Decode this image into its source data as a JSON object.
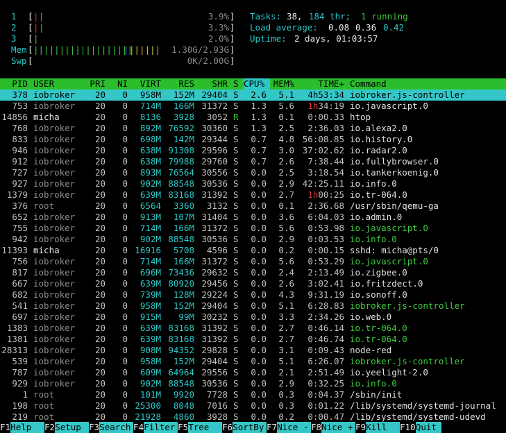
{
  "meters": {
    "cpus": [
      {
        "id": "1",
        "percent": "3.9%",
        "red_bars": "|",
        "green_bars": "|"
      },
      {
        "id": "2",
        "percent": "3.3%",
        "red_bars": "|",
        "green_bars": "|"
      },
      {
        "id": "3",
        "percent": "2.0%",
        "red_bars": "",
        "green_bars": "|"
      }
    ],
    "mem": {
      "label": "Mem",
      "green_bars": "|||||||||||||||||||",
      "blue_bars": "|",
      "yellow_bars": "||||||",
      "value": "1.30G/2.93G"
    },
    "swp": {
      "label": "Swp",
      "value": "0K/2.00G"
    }
  },
  "summary": {
    "tasks_label": "Tasks:",
    "tasks_value": "38,",
    "threads_value": "184 thr;",
    "running_value": "1 running",
    "load_label": "Load average:",
    "load_1": "0.08",
    "load_5": "0.36",
    "load_15": "0.42",
    "uptime_label": "Uptime:",
    "uptime_value": "2 days, 01:03:57"
  },
  "columns": [
    "PID",
    "USER",
    "PRI",
    "NI",
    "VIRT",
    "RES",
    "SHR",
    "S",
    "CPU%",
    "MEM%",
    "TIME+",
    "Command"
  ],
  "processes": [
    {
      "pid": "378",
      "user": "iobroker",
      "pri": "20",
      "ni": "0",
      "virt": "958M",
      "res": "152M",
      "shr": "29404",
      "s": "S",
      "cpu": "2.6",
      "mem": "5.1",
      "time": "4h53:34",
      "cmd": "iobroker.js-controller",
      "selected": true
    },
    {
      "pid": "753",
      "user": "iobroker",
      "pri": "20",
      "ni": "0",
      "virt": "714M",
      "res": "166M",
      "shr": "31372",
      "s": "S",
      "cpu": "1.3",
      "mem": "5.6",
      "time_h": "1h",
      "time": "34:19",
      "cmd": "io.javascript.0"
    },
    {
      "pid": "14856",
      "user": "micha",
      "pri": "20",
      "ni": "0",
      "virt": "8136",
      "res": "3928",
      "shr": "3052",
      "s": "R",
      "cpu": "1.3",
      "mem": "0.1",
      "time": "0:00.33",
      "cmd": "htop"
    },
    {
      "pid": "768",
      "user": "iobroker",
      "pri": "20",
      "ni": "0",
      "virt": "892M",
      "res": "76592",
      "shr": "30360",
      "s": "S",
      "cpu": "1.3",
      "mem": "2.5",
      "time": "2:36.03",
      "cmd": "io.alexa2.0"
    },
    {
      "pid": "833",
      "user": "iobroker",
      "pri": "20",
      "ni": "0",
      "virt": "698M",
      "res": "142M",
      "shr": "29344",
      "s": "S",
      "cpu": "0.7",
      "mem": "4.8",
      "time": "56:08.85",
      "cmd": "io.history.0"
    },
    {
      "pid": "946",
      "user": "iobroker",
      "pri": "20",
      "ni": "0",
      "virt": "638M",
      "res": "91308",
      "shr": "29596",
      "s": "S",
      "cpu": "0.7",
      "mem": "3.0",
      "time": "37:02.62",
      "cmd": "io.radar2.0"
    },
    {
      "pid": "912",
      "user": "iobroker",
      "pri": "20",
      "ni": "0",
      "virt": "638M",
      "res": "79988",
      "shr": "29760",
      "s": "S",
      "cpu": "0.7",
      "mem": "2.6",
      "time": "7:38.44",
      "cmd": "io.fullybrowser.0"
    },
    {
      "pid": "727",
      "user": "iobroker",
      "pri": "20",
      "ni": "0",
      "virt": "893M",
      "res": "76564",
      "shr": "30556",
      "s": "S",
      "cpu": "0.0",
      "mem": "2.5",
      "time": "3:18.54",
      "cmd": "io.tankerkoenig.0"
    },
    {
      "pid": "927",
      "user": "iobroker",
      "pri": "20",
      "ni": "0",
      "virt": "902M",
      "res": "88548",
      "shr": "30536",
      "s": "S",
      "cpu": "0.0",
      "mem": "2.9",
      "time": "42:25.11",
      "cmd": "io.info.0"
    },
    {
      "pid": "1379",
      "user": "iobroker",
      "pri": "20",
      "ni": "0",
      "virt": "639M",
      "res": "83168",
      "shr": "31392",
      "s": "S",
      "cpu": "0.0",
      "mem": "2.7",
      "time_h": "1h",
      "time": "00:25",
      "cmd": "io.tr-064.0"
    },
    {
      "pid": "376",
      "user": "root",
      "pri": "20",
      "ni": "0",
      "virt": "6564",
      "res": "3360",
      "shr": "3132",
      "s": "S",
      "cpu": "0.0",
      "mem": "0.1",
      "time": "2:36.68",
      "cmd": "/usr/sbin/qemu-ga"
    },
    {
      "pid": "652",
      "user": "iobroker",
      "pri": "20",
      "ni": "0",
      "virt": "913M",
      "res": "107M",
      "shr": "31404",
      "s": "S",
      "cpu": "0.0",
      "mem": "3.6",
      "time": "6:04.03",
      "cmd": "io.admin.0"
    },
    {
      "pid": "755",
      "user": "iobroker",
      "pri": "20",
      "ni": "0",
      "virt": "714M",
      "res": "166M",
      "shr": "31372",
      "s": "S",
      "cpu": "0.0",
      "mem": "5.6",
      "time": "0:53.98",
      "cmd": "io.javascript.0",
      "thread": true
    },
    {
      "pid": "942",
      "user": "iobroker",
      "pri": "20",
      "ni": "0",
      "virt": "902M",
      "res": "88548",
      "shr": "30536",
      "s": "S",
      "cpu": "0.0",
      "mem": "2.9",
      "time": "0:03.53",
      "cmd": "io.info.0",
      "thread": true
    },
    {
      "pid": "11393",
      "user": "micha",
      "pri": "20",
      "ni": "0",
      "virt": "16916",
      "res": "5708",
      "shr": "4596",
      "s": "S",
      "cpu": "0.0",
      "mem": "0.2",
      "time": "0:00.15",
      "cmd": "sshd: micha@pts/0"
    },
    {
      "pid": "756",
      "user": "iobroker",
      "pri": "20",
      "ni": "0",
      "virt": "714M",
      "res": "166M",
      "shr": "31372",
      "s": "S",
      "cpu": "0.0",
      "mem": "5.6",
      "time": "0:53.29",
      "cmd": "io.javascript.0",
      "thread": true
    },
    {
      "pid": "817",
      "user": "iobroker",
      "pri": "20",
      "ni": "0",
      "virt": "696M",
      "res": "73436",
      "shr": "29632",
      "s": "S",
      "cpu": "0.0",
      "mem": "2.4",
      "time": "2:13.49",
      "cmd": "io.zigbee.0"
    },
    {
      "pid": "667",
      "user": "iobroker",
      "pri": "20",
      "ni": "0",
      "virt": "639M",
      "res": "80920",
      "shr": "29456",
      "s": "S",
      "cpu": "0.0",
      "mem": "2.6",
      "time": "3:02.41",
      "cmd": "io.fritzdect.0"
    },
    {
      "pid": "682",
      "user": "iobroker",
      "pri": "20",
      "ni": "0",
      "virt": "739M",
      "res": "128M",
      "shr": "29224",
      "s": "S",
      "cpu": "0.0",
      "mem": "4.3",
      "time": "9:31.19",
      "cmd": "io.sonoff.0"
    },
    {
      "pid": "541",
      "user": "iobroker",
      "pri": "20",
      "ni": "0",
      "virt": "958M",
      "res": "152M",
      "shr": "29404",
      "s": "S",
      "cpu": "0.0",
      "mem": "5.1",
      "time": "6:28.83",
      "cmd": "iobroker.js-controller",
      "thread": true
    },
    {
      "pid": "697",
      "user": "iobroker",
      "pri": "20",
      "ni": "0",
      "virt": "915M",
      "res": "99M",
      "shr": "30232",
      "s": "S",
      "cpu": "0.0",
      "mem": "3.3",
      "time": "2:34.26",
      "cmd": "io.web.0"
    },
    {
      "pid": "1383",
      "user": "iobroker",
      "pri": "20",
      "ni": "0",
      "virt": "639M",
      "res": "83168",
      "shr": "31392",
      "s": "S",
      "cpu": "0.0",
      "mem": "2.7",
      "time": "0:46.14",
      "cmd": "io.tr-064.0",
      "thread": true
    },
    {
      "pid": "1381",
      "user": "iobroker",
      "pri": "20",
      "ni": "0",
      "virt": "639M",
      "res": "83168",
      "shr": "31392",
      "s": "S",
      "cpu": "0.0",
      "mem": "2.7",
      "time": "0:46.74",
      "cmd": "io.tr-064.0",
      "thread": true
    },
    {
      "pid": "28313",
      "user": "iobroker",
      "pri": "20",
      "ni": "0",
      "virt": "908M",
      "res": "94352",
      "shr": "29828",
      "s": "S",
      "cpu": "0.0",
      "mem": "3.1",
      "time": "0:09.43",
      "cmd": "node-red"
    },
    {
      "pid": "539",
      "user": "iobroker",
      "pri": "20",
      "ni": "0",
      "virt": "958M",
      "res": "152M",
      "shr": "29404",
      "s": "S",
      "cpu": "0.0",
      "mem": "5.1",
      "time": "6:26.07",
      "cmd": "iobroker.js-controller",
      "thread": true
    },
    {
      "pid": "787",
      "user": "iobroker",
      "pri": "20",
      "ni": "0",
      "virt": "609M",
      "res": "64964",
      "shr": "29556",
      "s": "S",
      "cpu": "0.0",
      "mem": "2.1",
      "time": "2:51.49",
      "cmd": "io.yeelight-2.0"
    },
    {
      "pid": "929",
      "user": "iobroker",
      "pri": "20",
      "ni": "0",
      "virt": "902M",
      "res": "88548",
      "shr": "30536",
      "s": "S",
      "cpu": "0.0",
      "mem": "2.9",
      "time": "0:32.25",
      "cmd": "io.info.0",
      "thread": true
    },
    {
      "pid": "1",
      "user": "root",
      "pri": "20",
      "ni": "0",
      "virt": "101M",
      "res": "9920",
      "shr": "7728",
      "s": "S",
      "cpu": "0.0",
      "mem": "0.3",
      "time": "0:04.37",
      "cmd": "/sbin/init"
    },
    {
      "pid": "198",
      "user": "root",
      "pri": "20",
      "ni": "0",
      "virt": "25300",
      "res": "8048",
      "shr": "7016",
      "s": "S",
      "cpu": "0.0",
      "mem": "0.3",
      "time": "0:01.22",
      "cmd": "/lib/systemd/systemd-journal"
    },
    {
      "pid": "219",
      "user": "root",
      "pri": "20",
      "ni": "0",
      "virt": "21928",
      "res": "4860",
      "shr": "3928",
      "s": "S",
      "cpu": "0.0",
      "mem": "0.2",
      "time": "0:00.47",
      "cmd": "/lib/systemd/systemd-udevd"
    }
  ],
  "fkeys": [
    {
      "key": "F1",
      "label": "Help"
    },
    {
      "key": "F2",
      "label": "Setup"
    },
    {
      "key": "F3",
      "label": "Search"
    },
    {
      "key": "F4",
      "label": "Filter"
    },
    {
      "key": "F5",
      "label": "Tree"
    },
    {
      "key": "F6",
      "label": "SortBy"
    },
    {
      "key": "F7",
      "label": "Nice -"
    },
    {
      "key": "F8",
      "label": "Nice +"
    },
    {
      "key": "F9",
      "label": "Kill"
    },
    {
      "key": "F10",
      "label": "Quit"
    }
  ],
  "colors": {
    "header_bg": "#2bbd2b",
    "selected_bg": "#35c7c7",
    "cyan": "#2ec7c7",
    "green": "#3fcb3f",
    "red": "#d23a3a"
  }
}
